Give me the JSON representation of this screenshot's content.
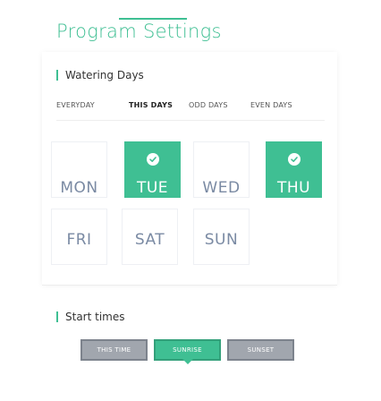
{
  "page": {
    "title": "Program Settings"
  },
  "watering": {
    "label": "Watering Days",
    "tabs": [
      {
        "label": "EVERYDAY"
      },
      {
        "label": "THIS DAYS",
        "active": true
      },
      {
        "label": "ODD DAYS"
      },
      {
        "label": "EVEN DAYS"
      }
    ],
    "days": [
      {
        "label": "MON",
        "selected": false
      },
      {
        "label": "TUE",
        "selected": true
      },
      {
        "label": "WED",
        "selected": false
      },
      {
        "label": "THU",
        "selected": true
      },
      {
        "label": "FRI",
        "selected": false
      },
      {
        "label": "SAT",
        "selected": false
      },
      {
        "label": "SUN",
        "selected": false
      }
    ]
  },
  "start": {
    "label": "Start times",
    "buttons": [
      {
        "label": "THIS TIME",
        "style": "gray"
      },
      {
        "label": "SUNRISE",
        "style": "green",
        "active": true
      },
      {
        "label": "SUNSET",
        "style": "gray"
      }
    ]
  },
  "colors": {
    "accent": "#3fbf93",
    "gray_button": "#a1a6ae",
    "day_text": "#7a8aa3"
  },
  "icons": {
    "check": "check-circle-icon"
  }
}
